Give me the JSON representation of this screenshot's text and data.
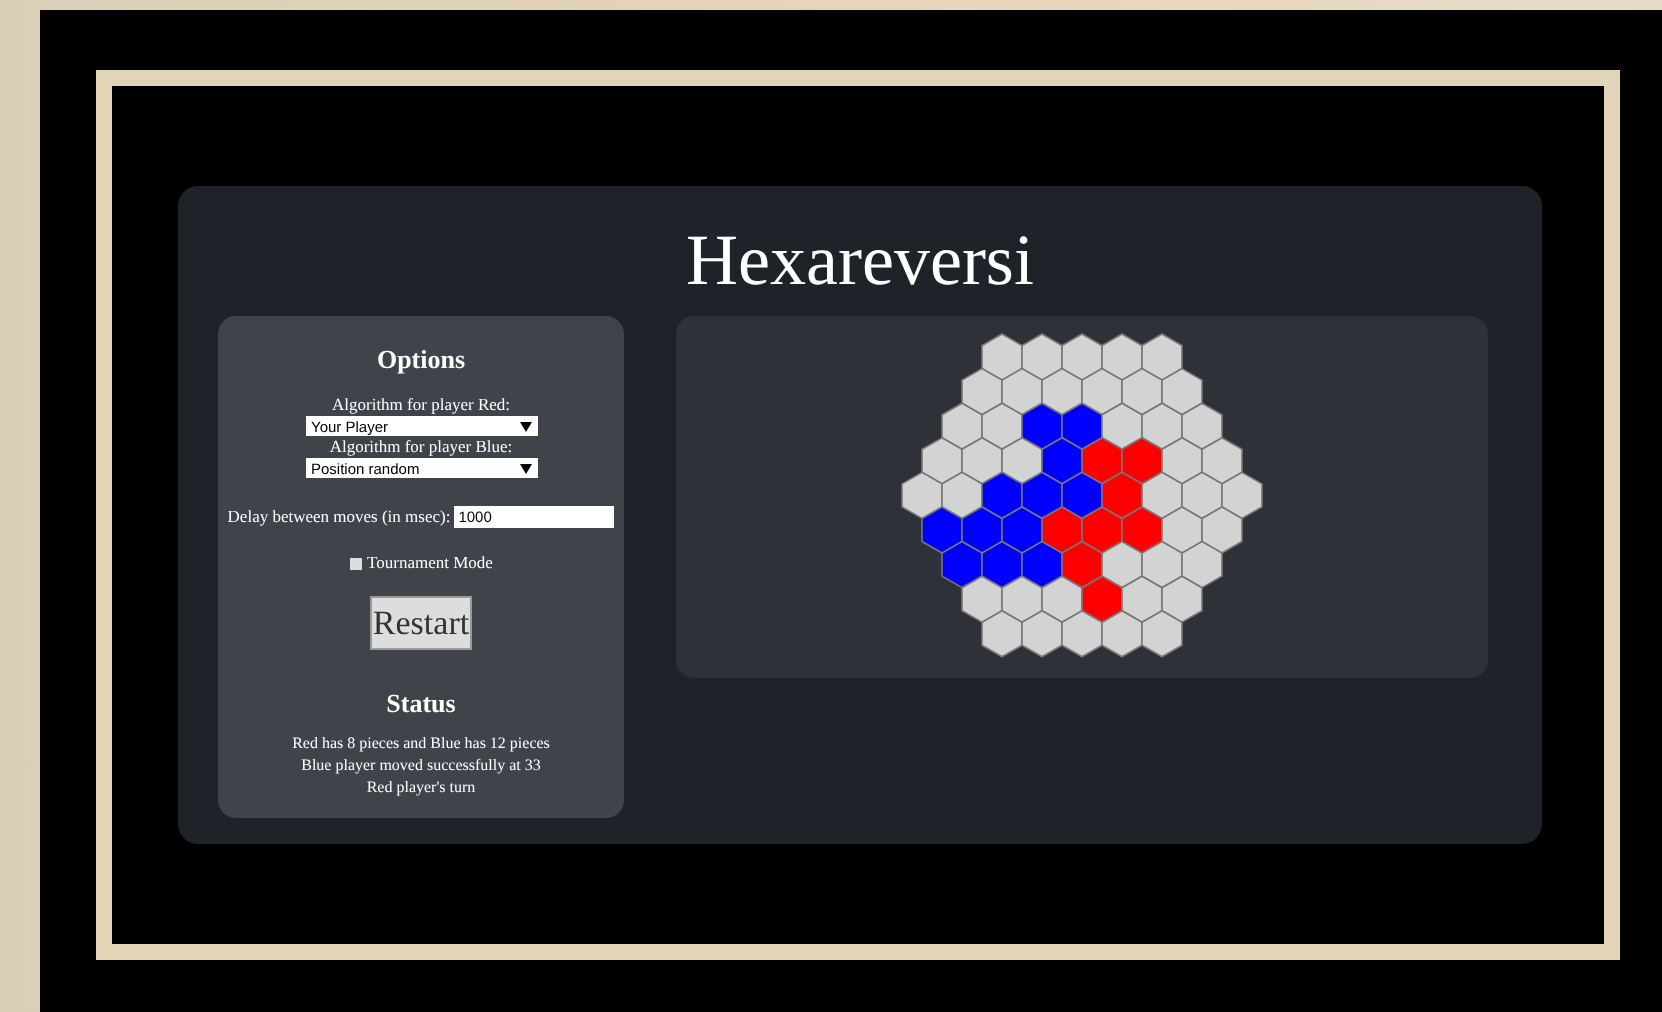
{
  "title": "Hexareversi",
  "options": {
    "heading": "Options",
    "red_algorithm": {
      "label": "Algorithm for player Red:",
      "value": "Your Player"
    },
    "blue_algorithm": {
      "label": "Algorithm for player Blue:",
      "value": "Position random"
    },
    "delay": {
      "label": "Delay between moves (in msec):",
      "value": "1000"
    },
    "tournament_mode": {
      "label": "Tournament Mode",
      "checked": false
    },
    "restart_button": "Restart"
  },
  "status": {
    "heading": "Status",
    "lines": [
      "Red has 8 pieces and Blue has 12 pieces",
      "Blue player moved successfully at 33",
      "Red player's turn"
    ]
  },
  "board": {
    "rows": [
      [
        {
          "color": "#d3d3d3"
        },
        {
          "color": "#d3d3d3"
        },
        {
          "color": "#d3d3d3"
        },
        {
          "color": "#d3d3d3"
        },
        {
          "color": "#d3d3d3"
        }
      ],
      [
        {
          "color": "#d3d3d3"
        },
        {
          "color": "#d3d3d3"
        },
        {
          "color": "#d3d3d3"
        },
        {
          "color": "#d3d3d3"
        },
        {
          "color": "#d3d3d3"
        },
        {
          "color": "#d3d3d3"
        }
      ],
      [
        {
          "color": "#d3d3d3"
        },
        {
          "color": "#d3d3d3"
        },
        {
          "color": "#0000ff"
        },
        {
          "color": "#0000ff"
        },
        {
          "color": "#d3d3d3"
        },
        {
          "color": "#d3d3d3"
        },
        {
          "color": "#d3d3d3"
        }
      ],
      [
        {
          "color": "#d3d3d3"
        },
        {
          "color": "#d3d3d3"
        },
        {
          "color": "#d3d3d3"
        },
        {
          "color": "#0000ff"
        },
        {
          "color": "#ff0000"
        },
        {
          "color": "#ff0000"
        },
        {
          "color": "#d3d3d3"
        },
        {
          "color": "#d3d3d3"
        }
      ],
      [
        {
          "color": "#d3d3d3"
        },
        {
          "color": "#d3d3d3"
        },
        {
          "color": "#0000ff"
        },
        {
          "color": "#0000ff"
        },
        {
          "color": "#0000ff"
        },
        {
          "color": "#ff0000"
        },
        {
          "color": "#d3d3d3"
        },
        {
          "color": "#d3d3d3"
        },
        {
          "color": "#d3d3d3"
        }
      ],
      [
        {
          "color": "#0000ff"
        },
        {
          "color": "#0000ff"
        },
        {
          "color": "#0000ff"
        },
        {
          "color": "#ff0000"
        },
        {
          "color": "#ff0000"
        },
        {
          "color": "#ff0000"
        },
        {
          "color": "#d3d3d3"
        },
        {
          "color": "#d3d3d3"
        }
      ],
      [
        {
          "color": "#0000ff"
        },
        {
          "color": "#0000ff"
        },
        {
          "color": "#0000ff"
        },
        {
          "color": "#ff0000"
        },
        {
          "color": "#d3d3d3"
        },
        {
          "color": "#d3d3d3"
        },
        {
          "color": "#d3d3d3"
        }
      ],
      [
        {
          "color": "#d3d3d3"
        },
        {
          "color": "#d3d3d3"
        },
        {
          "color": "#d3d3d3"
        },
        {
          "color": "#ff0000"
        },
        {
          "color": "#d3d3d3"
        },
        {
          "color": "#d3d3d3"
        }
      ],
      [
        {
          "color": "#d3d3d3"
        },
        {
          "color": "#d3d3d3"
        },
        {
          "color": "#d3d3d3"
        },
        {
          "color": "#d3d3d3"
        },
        {
          "color": "#d3d3d3"
        }
      ]
    ]
  }
}
